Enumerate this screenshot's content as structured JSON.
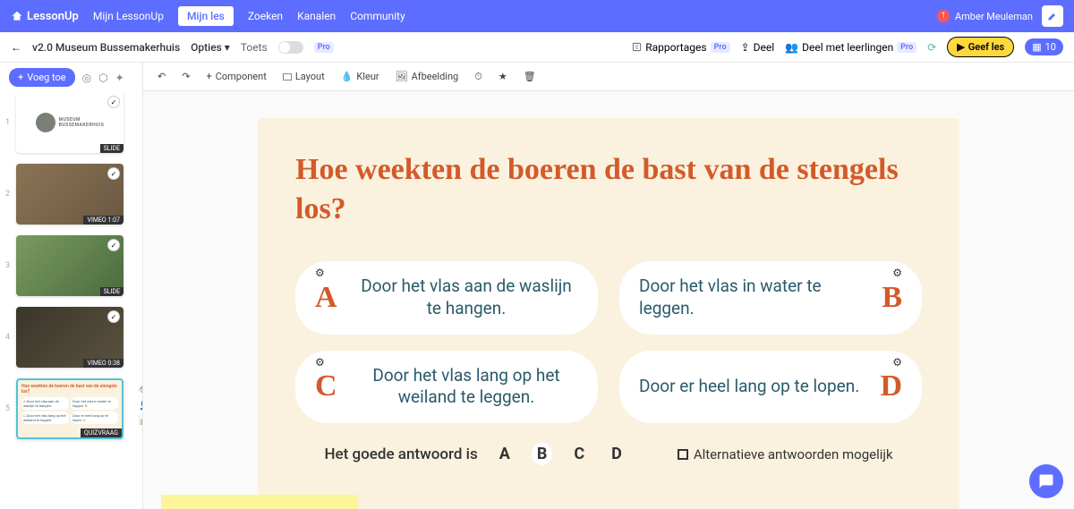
{
  "nav": {
    "brand": "LessonUp",
    "items": [
      "Mijn LessonUp",
      "Mijn les",
      "Zoeken",
      "Kanalen",
      "Community"
    ],
    "active_index": 1,
    "user_name": "Amber Meuleman",
    "notif_count": "1"
  },
  "subbar": {
    "title": "v2.0 Museum Bussemakerhuis",
    "opties": "Opties",
    "toets": "Toets",
    "rapportages": "Rapportages",
    "deel": "Deel",
    "deel_leerlingen": "Deel met leerlingen",
    "geef_les": "Geef les",
    "count": "10",
    "pro": "Pro"
  },
  "sidebar": {
    "voeg_toe": "Voeg toe",
    "thumbs": [
      {
        "num": "1",
        "label": "SLIDE",
        "type": "logo",
        "museum": "MUSEUM",
        "sub": "BUSSEMAKERHUIS"
      },
      {
        "num": "2",
        "label": "VIMEO 1:07",
        "type": "img"
      },
      {
        "num": "3",
        "label": "SLIDE",
        "type": "img"
      },
      {
        "num": "4",
        "label": "VIMEO 0:38",
        "type": "img"
      },
      {
        "num": "5",
        "label": "QUIZVRAAG",
        "type": "quiz",
        "selected": true
      }
    ]
  },
  "toolbar": {
    "component": "Component",
    "layout": "Layout",
    "kleur": "Kleur",
    "afbeelding": "Afbeelding"
  },
  "slide": {
    "question": "Hoe weekten de boeren de bast van de stengels los?",
    "options": [
      {
        "letter": "A",
        "text": "Door het vlas aan de waslijn te hangen."
      },
      {
        "letter": "B",
        "text": "Door het vlas in water te leggen."
      },
      {
        "letter": "C",
        "text": "Door het vlas lang op het weiland te leggen."
      },
      {
        "letter": "D",
        "text": "Door er heel lang op te lopen."
      }
    ],
    "answer_label": "Het goede antwoord is",
    "answer_letters": [
      "A",
      "B",
      "C",
      "D"
    ],
    "answer_selected": "B",
    "alternative": "Alternatieve antwoorden mogelijk"
  }
}
